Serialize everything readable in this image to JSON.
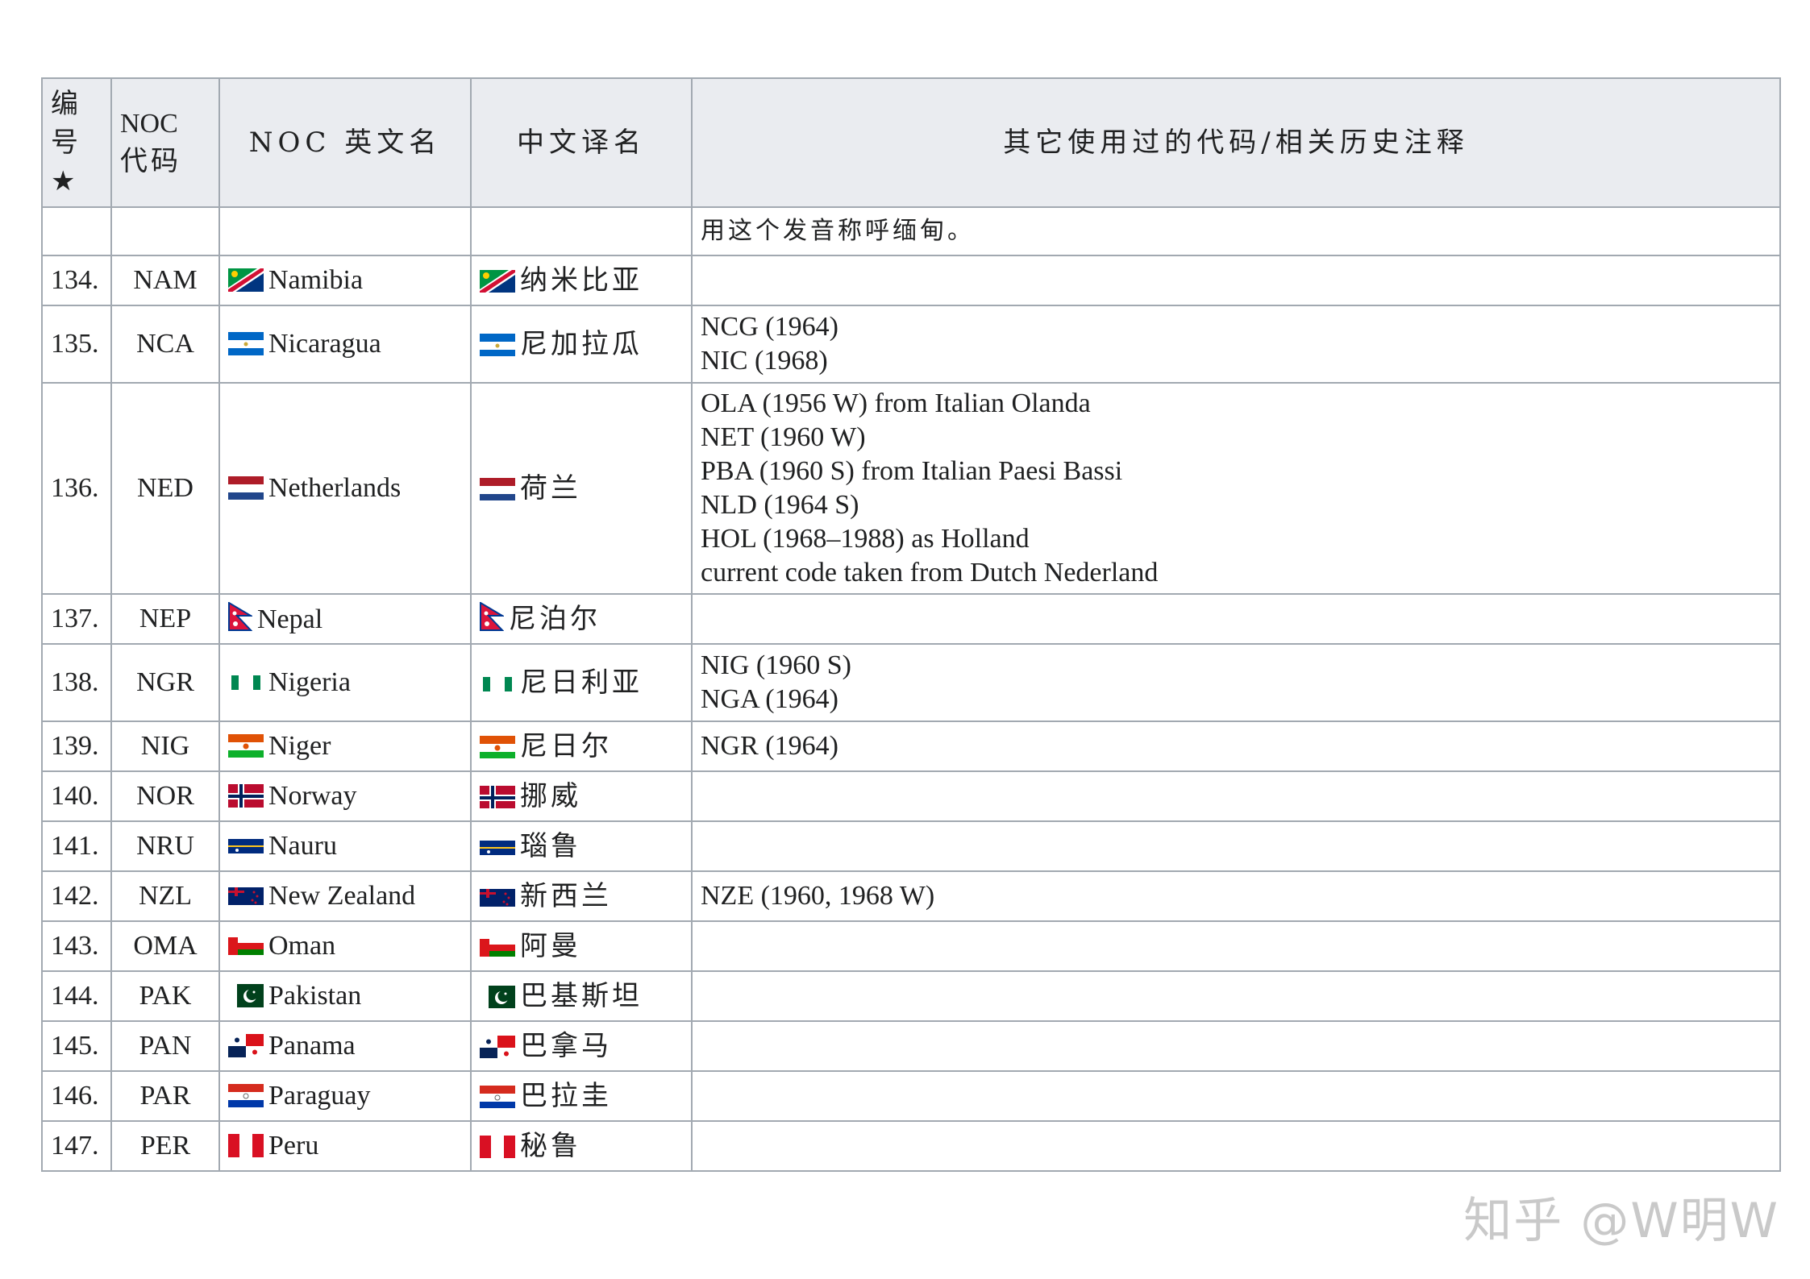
{
  "header": {
    "num": [
      "编",
      "号",
      "★"
    ],
    "code": [
      "NOC",
      "代码"
    ],
    "en_name": "NOC 英文名",
    "cn_name": "中文译名",
    "notes": "其它使用过的代码/相关历史注释"
  },
  "carry_row": {
    "notes": "用这个发音称呼缅甸。"
  },
  "rows": [
    {
      "num": "134.",
      "code": "NAM",
      "en": "Namibia",
      "cn": "纳米比亚",
      "flag": "namibia-flag-icon",
      "notes": []
    },
    {
      "num": "135.",
      "code": "NCA",
      "en": "Nicaragua",
      "cn": "尼加拉瓜",
      "flag": "nicaragua-flag-icon",
      "notes": [
        "NCG (1964)",
        "NIC (1968)"
      ]
    },
    {
      "num": "136.",
      "code": "NED",
      "en": "Netherlands",
      "cn": "荷兰",
      "flag": "netherlands-flag-icon",
      "notes": [
        "OLA (1956 W) from Italian Olanda",
        "NET (1960 W)",
        "PBA (1960 S) from Italian Paesi Bassi",
        "NLD (1964 S)",
        "HOL (1968–1988) as Holland",
        "current code taken from Dutch Nederland"
      ]
    },
    {
      "num": "137.",
      "code": "NEP",
      "en": "Nepal",
      "cn": "尼泊尔",
      "flag": "nepal-flag-icon",
      "notes": []
    },
    {
      "num": "138.",
      "code": "NGR",
      "en": "Nigeria",
      "cn": "尼日利亚",
      "flag": "nigeria-flag-icon",
      "notes": [
        "NIG (1960 S)",
        "NGA (1964)"
      ]
    },
    {
      "num": "139.",
      "code": "NIG",
      "en": "Niger",
      "cn": "尼日尔",
      "flag": "niger-flag-icon",
      "notes": [
        "NGR (1964)"
      ]
    },
    {
      "num": "140.",
      "code": "NOR",
      "en": "Norway",
      "cn": "挪威",
      "flag": "norway-flag-icon",
      "notes": []
    },
    {
      "num": "141.",
      "code": "NRU",
      "en": "Nauru",
      "cn": "瑙鲁",
      "flag": "nauru-flag-icon",
      "notes": []
    },
    {
      "num": "142.",
      "code": "NZL",
      "en": "New Zealand",
      "cn": "新西兰",
      "flag": "new-zealand-flag-icon",
      "notes": [
        "NZE (1960, 1968 W)"
      ]
    },
    {
      "num": "143.",
      "code": "OMA",
      "en": "Oman",
      "cn": "阿曼",
      "flag": "oman-flag-icon",
      "notes": []
    },
    {
      "num": "144.",
      "code": "PAK",
      "en": "Pakistan",
      "cn": "巴基斯坦",
      "flag": "pakistan-flag-icon",
      "notes": []
    },
    {
      "num": "145.",
      "code": "PAN",
      "en": "Panama",
      "cn": "巴拿马",
      "flag": "panama-flag-icon",
      "notes": []
    },
    {
      "num": "146.",
      "code": "PAR",
      "en": "Paraguay",
      "cn": "巴拉圭",
      "flag": "paraguay-flag-icon",
      "notes": []
    },
    {
      "num": "147.",
      "code": "PER",
      "en": "Peru",
      "cn": "秘鲁",
      "flag": "peru-flag-icon",
      "notes": []
    }
  ],
  "watermark": "知乎 @W明W"
}
